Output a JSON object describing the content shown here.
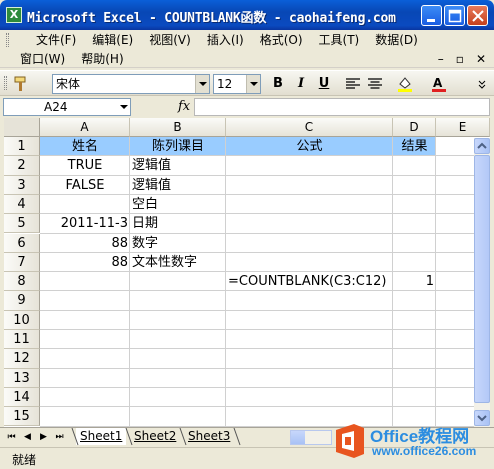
{
  "window": {
    "title": "Microsoft Excel - COUNTBLANK函数 - caohaifeng.com"
  },
  "menu": {
    "row1": [
      "文件(F)",
      "编辑(E)",
      "视图(V)",
      "插入(I)",
      "格式(O)",
      "工具(T)",
      "数据(D)"
    ],
    "row2": [
      "窗口(W)",
      "帮助(H)"
    ]
  },
  "toolbar": {
    "font_name": "宋体",
    "font_size": "12",
    "bold_label": "B",
    "italic_label": "I",
    "underline_label": "U"
  },
  "formula_bar": {
    "name_box": "A24",
    "fx_label": "fx",
    "formula": ""
  },
  "grid": {
    "columns": [
      "A",
      "B",
      "C",
      "D",
      "E"
    ],
    "rows": [
      "1",
      "2",
      "3",
      "4",
      "5",
      "6",
      "7",
      "8",
      "9",
      "10",
      "11",
      "12",
      "13",
      "14",
      "15"
    ],
    "cells": {
      "A1": "姓名",
      "B1": "陈列课目",
      "C1": "公式",
      "D1": "结果",
      "A2": "TRUE",
      "B2": "逻辑值",
      "A3": "FALSE",
      "B3": "逻辑值",
      "B4": "空白",
      "A5": "2011-11-3",
      "B5": "日期",
      "A6": "88",
      "B6": "数字",
      "A7": "88",
      "B7": "文本性数字",
      "C8": "=COUNTBLANK(C3:C12)",
      "D8": "1"
    },
    "header_fill_color": "#99ccff"
  },
  "sheets": {
    "tabs": [
      "Sheet1",
      "Sheet2",
      "Sheet3"
    ],
    "active": "Sheet1"
  },
  "status": {
    "text": "就绪"
  },
  "watermark": {
    "title": "Office教程网",
    "url": "www.office26.com"
  }
}
